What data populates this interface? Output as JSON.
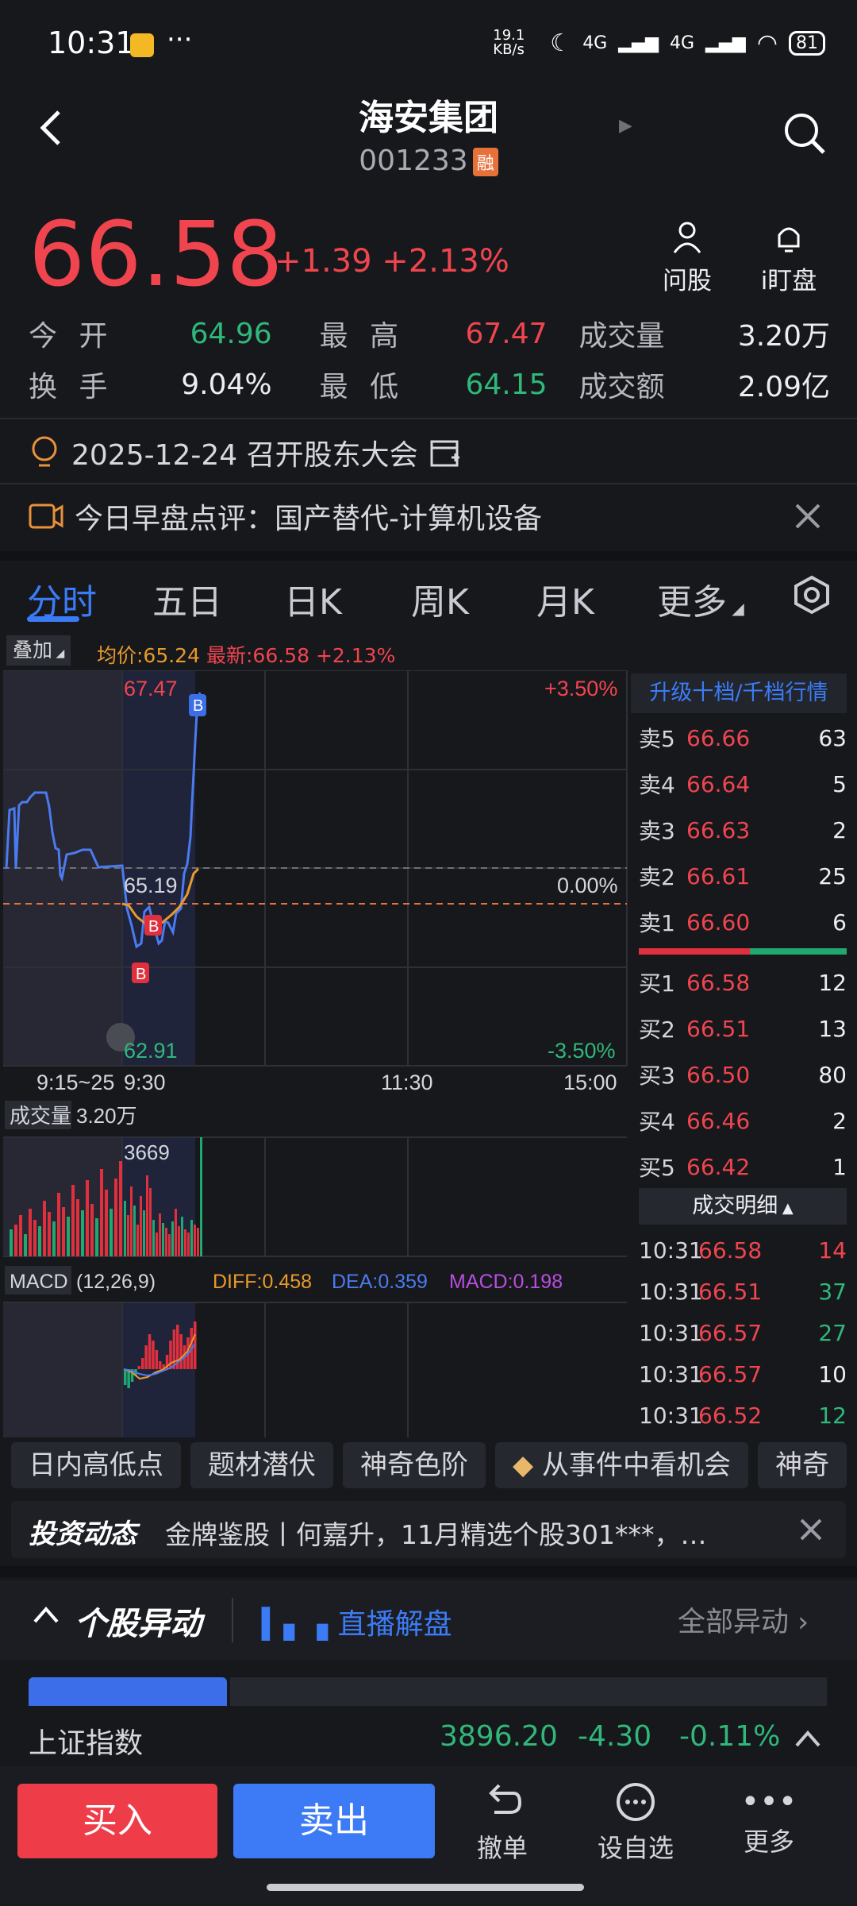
{
  "status_bar": {
    "time": "10:31",
    "net_speed": "19.1 KB/s",
    "signal1": "4G",
    "signal2": "4G",
    "battery": "81"
  },
  "header": {
    "title": "海安集团",
    "code": "001233",
    "badge": "融"
  },
  "quote": {
    "price": "66.58",
    "change": "+1.39",
    "change_pct": "+2.13%",
    "ask_btn": "问股",
    "watch_btn": "i盯盘"
  },
  "stats": {
    "open_label": "今 开",
    "open_value": "64.96",
    "high_label": "最 高",
    "high_value": "67.47",
    "volume_label": "成交量",
    "volume_value": "3.20万",
    "turnover_label": "换 手",
    "turnover_value": "9.04%",
    "low_label": "最 低",
    "low_value": "64.15",
    "amount_label": "成交额",
    "amount_value": "2.09亿"
  },
  "banners": {
    "meeting": "2025-12-24 召开股东大会",
    "review": "今日早盘点评：国产替代-计算机设备"
  },
  "tabs": [
    "分时",
    "五日",
    "日K",
    "周K",
    "月K",
    "更多"
  ],
  "overlay": {
    "label": "叠加",
    "avg": "均价:65.24",
    "latest": "最新:66.58",
    "latest_pct": "+2.13%"
  },
  "chart": {
    "high": "67.47",
    "base": "65.19",
    "low": "62.91",
    "pct_high": "+3.50%",
    "pct_zero": "0.00%",
    "pct_low": "-3.50%",
    "t1": "9:15~25",
    "t2": "9:30",
    "t3": "11:30",
    "t4": "15:00",
    "volume_label": "成交量",
    "volume_total": "3.20万",
    "volume_max": "3669",
    "macd_label": "MACD",
    "macd_params": "(12,26,9)",
    "diff": "DIFF:0.458",
    "dea": "DEA:0.359",
    "macd": "MACD:0.198",
    "marker_b": "B"
  },
  "book": {
    "header": "升级十档/千档行情",
    "asks": [
      {
        "label": "卖5",
        "price": "66.66",
        "qty": "63"
      },
      {
        "label": "卖4",
        "price": "66.64",
        "qty": "5"
      },
      {
        "label": "卖3",
        "price": "66.63",
        "qty": "2"
      },
      {
        "label": "卖2",
        "price": "66.61",
        "qty": "25"
      },
      {
        "label": "卖1",
        "price": "66.60",
        "qty": "6"
      }
    ],
    "bids": [
      {
        "label": "买1",
        "price": "66.58",
        "qty": "12"
      },
      {
        "label": "买2",
        "price": "66.51",
        "qty": "13"
      },
      {
        "label": "买3",
        "price": "66.50",
        "qty": "80"
      },
      {
        "label": "买4",
        "price": "66.46",
        "qty": "2"
      },
      {
        "label": "买5",
        "price": "66.42",
        "qty": "1"
      }
    ],
    "detail_header": "成交明细",
    "details": [
      {
        "time": "10:31",
        "price": "66.58",
        "qty": "14",
        "dir": "red"
      },
      {
        "time": "10:31",
        "price": "66.51",
        "qty": "37",
        "dir": "green"
      },
      {
        "time": "10:31",
        "price": "66.57",
        "qty": "27",
        "dir": "green"
      },
      {
        "time": "10:31",
        "price": "66.57",
        "qty": "10",
        "dir": "white"
      },
      {
        "time": "10:31",
        "price": "66.52",
        "qty": "12",
        "dir": "green"
      }
    ]
  },
  "chips": [
    "日内高低点",
    "题材潜伏",
    "神奇色阶",
    "从事件中看机会",
    "神奇"
  ],
  "news": {
    "tag": "投资动态",
    "text": "金牌鉴股丨何嘉升，11月精选个股301***，…"
  },
  "section": {
    "title": "个股异动",
    "live": "直播解盘",
    "all": "全部异动"
  },
  "index": {
    "name": "上证指数",
    "value": "3896.20",
    "change": "-4.30",
    "pct": "-0.11%"
  },
  "bottom": {
    "buy": "买入",
    "sell": "卖出",
    "cancel": "撤单",
    "watchlist": "设自选",
    "more": "更多"
  },
  "colors": {
    "up": "#f0454f",
    "down": "#2fb87a",
    "accent": "#3b7cf6",
    "avg_line": "#e89a2c"
  }
}
